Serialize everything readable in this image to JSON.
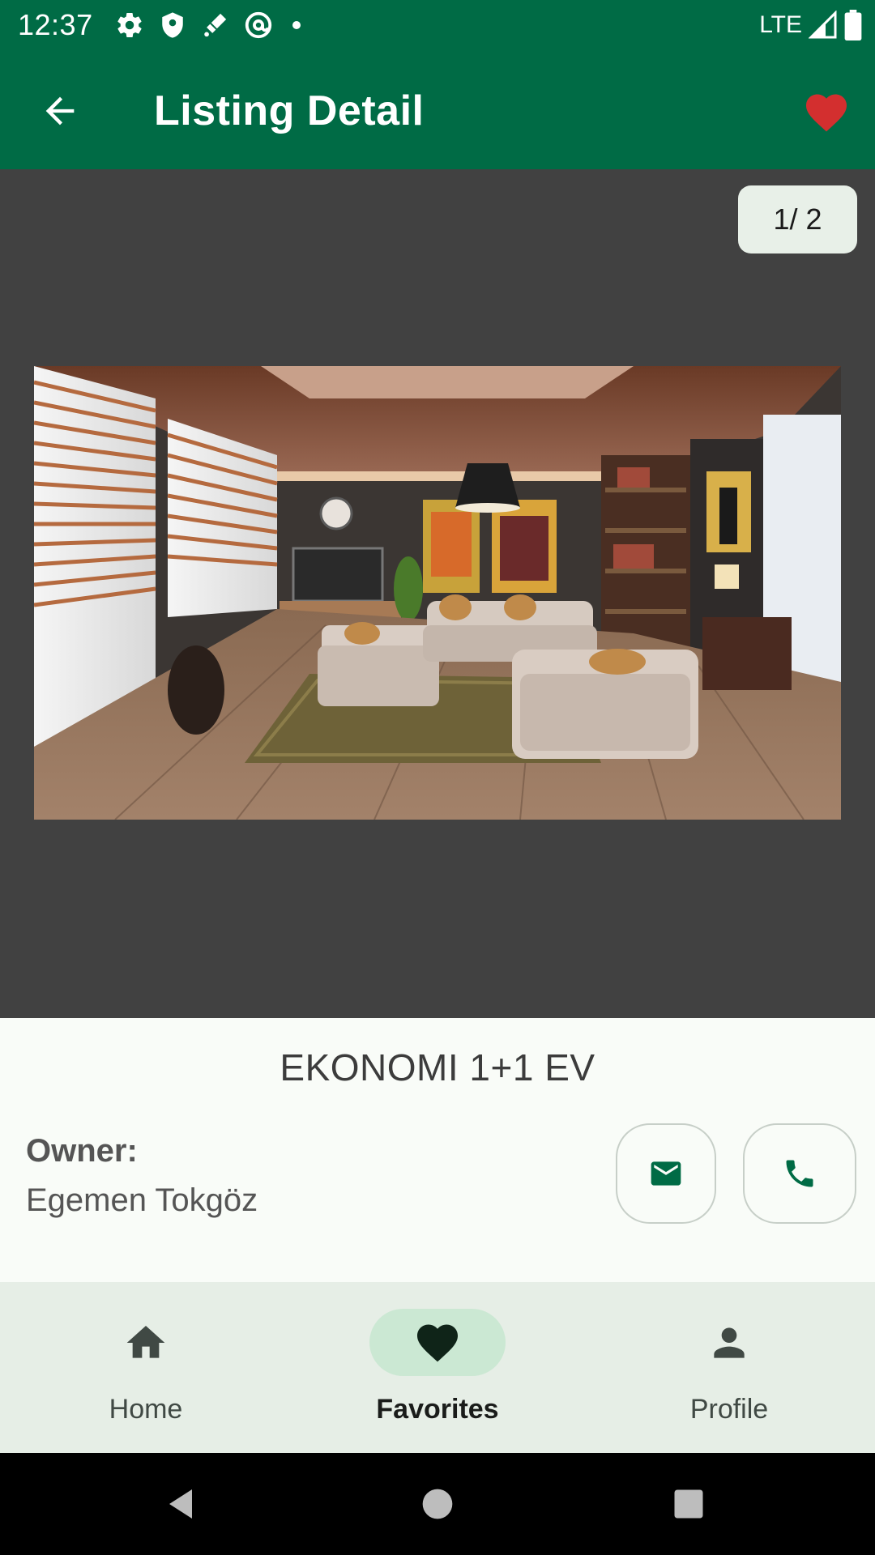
{
  "status_bar": {
    "time": "12:37",
    "network": "LTE",
    "icons": [
      "gear-icon",
      "shield-icon",
      "satellite-icon",
      "at-sign-icon",
      "dot-icon",
      "signal-icon",
      "battery-icon"
    ]
  },
  "app_bar": {
    "title": "Listing Detail",
    "back_icon": "arrow-left-icon",
    "favorite_icon": "heart-icon",
    "favorite_color": "#d32f2f"
  },
  "gallery": {
    "counter": "1/ 2",
    "current_index": 1,
    "total": 2
  },
  "listing": {
    "title": "EKONOMI 1+1 EV",
    "owner_label": "Owner:",
    "owner_name": "Egemen Tokgöz",
    "email_icon": "mail-icon",
    "phone_icon": "phone-icon"
  },
  "bottom_nav": {
    "items": [
      {
        "label": "Home",
        "icon": "home-icon",
        "active": false
      },
      {
        "label": "Favorites",
        "icon": "heart-icon",
        "active": true
      },
      {
        "label": "Profile",
        "icon": "person-icon",
        "active": false
      }
    ]
  },
  "colors": {
    "primary": "#006b45",
    "gallery_bg": "#414141",
    "nav_bg": "#e6eee6",
    "nav_indicator": "#cbe8d3"
  }
}
